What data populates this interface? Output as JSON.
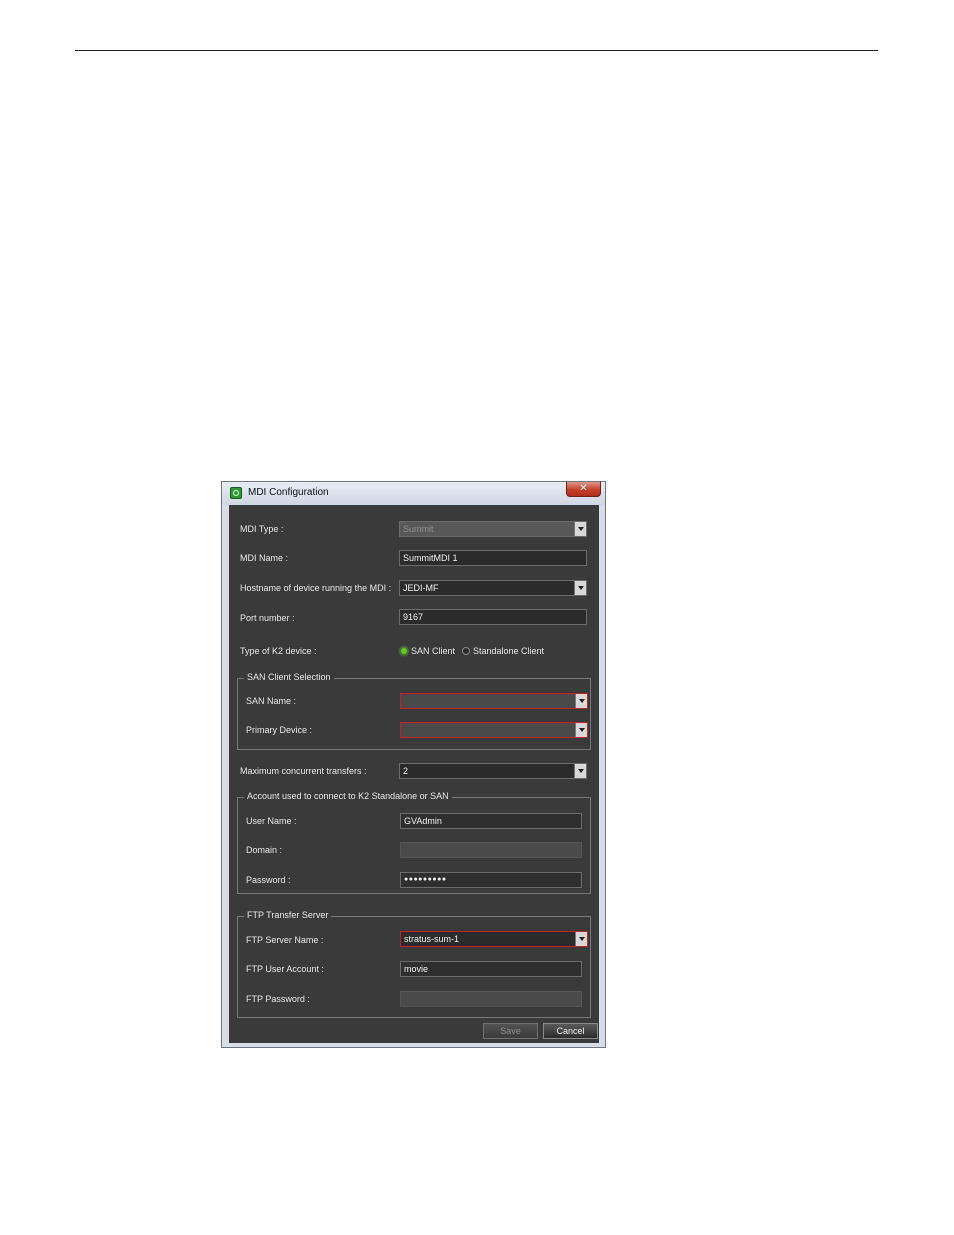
{
  "window": {
    "title": "MDI Configuration",
    "close_glyph": "✕"
  },
  "form": {
    "mdi_type": {
      "label": "MDI Type :",
      "value": "Summit"
    },
    "mdi_name": {
      "label": "MDI Name :",
      "value": "SummitMDI 1"
    },
    "hostname": {
      "label": "Hostname of device running the MDI :",
      "value": "JEDI-MF"
    },
    "port": {
      "label": "Port number :",
      "value": "9167"
    },
    "k2_device": {
      "label": "Type of K2 device :",
      "options": [
        "SAN Client",
        "Standalone Client"
      ],
      "selected": "SAN Client"
    },
    "san_group": {
      "title": "SAN Client Selection",
      "san_name": {
        "label": "SAN Name :",
        "value": ""
      },
      "primary_device": {
        "label": "Primary Device :",
        "value": ""
      }
    },
    "max_transfers": {
      "label": "Maximum concurrent transfers :",
      "value": "2"
    },
    "account_group": {
      "title": "Account used to connect to K2 Standalone or SAN",
      "user_name": {
        "label": "User Name :",
        "value": "GVAdmin"
      },
      "domain": {
        "label": "Domain :",
        "value": ""
      },
      "password": {
        "label": "Password :",
        "value": "●●●●●●●●●"
      }
    },
    "ftp_group": {
      "title": "FTP Transfer Server",
      "server_name": {
        "label": "FTP Server Name :",
        "value": "stratus-sum-1"
      },
      "user_account": {
        "label": "FTP User Account :",
        "value": "movie"
      },
      "password": {
        "label": "FTP Password :",
        "value": ""
      }
    }
  },
  "buttons": {
    "save": "Save",
    "cancel": "Cancel"
  },
  "colors": {
    "client_bg": "#3a3a3a",
    "error_border": "#c4202a",
    "radio_on": "#68c33a"
  }
}
